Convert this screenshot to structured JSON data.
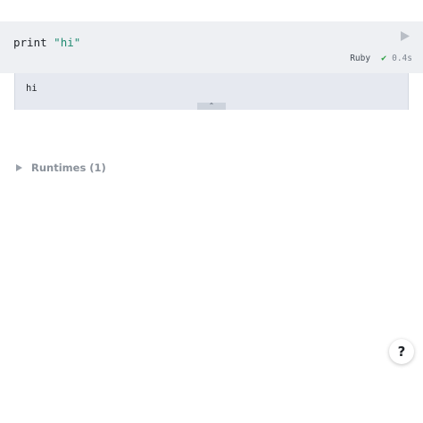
{
  "code_cell": {
    "keyword": "print",
    "string_literal": "\"hi\"",
    "run_icon": "play-icon",
    "language": "Ruby",
    "status_icon": "check-icon",
    "status_glyph": "✔",
    "duration": "0.4s"
  },
  "output": {
    "text": "hi",
    "collapse_icon": "chevron-up-icon",
    "collapse_glyph": "⌃"
  },
  "runtimes": {
    "label": "Runtimes (1)",
    "icon": "caret-right-icon"
  },
  "help": {
    "label": "?"
  },
  "colors": {
    "code_bg": "#eef0f3",
    "output_bg": "#e6e9f0",
    "string": "#1f8a70",
    "success": "#2ea043"
  }
}
